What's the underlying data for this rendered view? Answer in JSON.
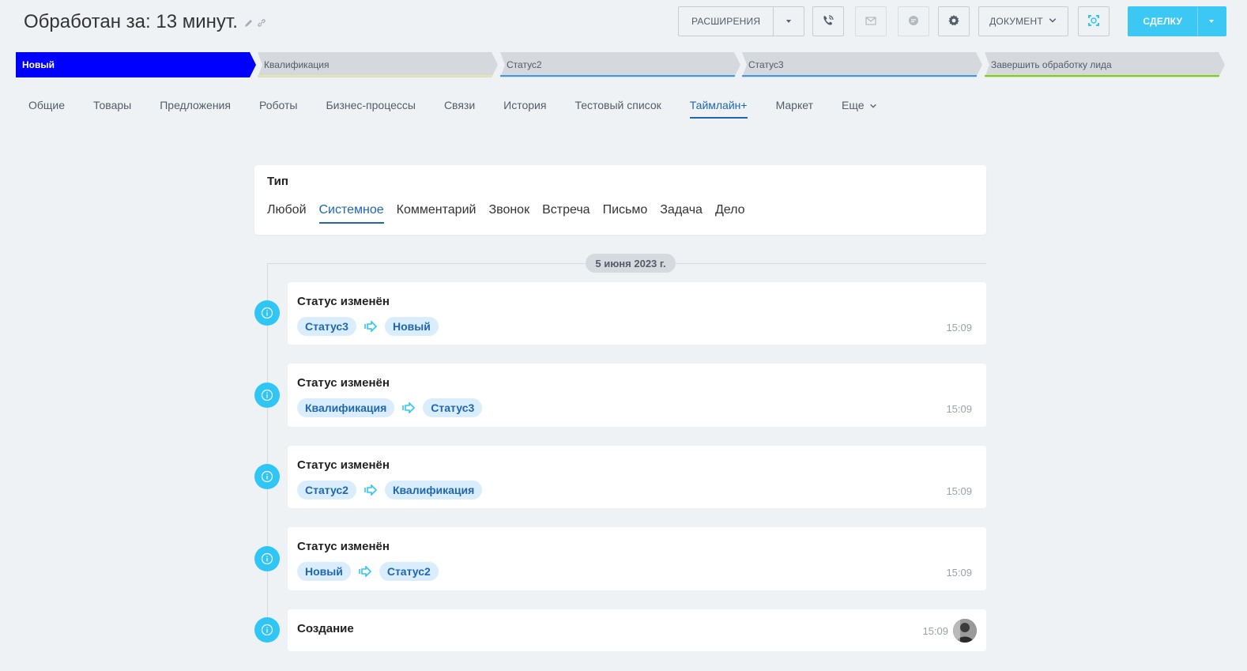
{
  "header": {
    "title": "Обработан за: 13 минут.",
    "extensions_label": "РАСШИРЕНИЯ",
    "document_label": "ДОКУМЕНТ",
    "deal_label": "СДЕЛКУ"
  },
  "stages": [
    {
      "label": "Новый",
      "color": "#0000ff",
      "active": true
    },
    {
      "label": "Квалификация",
      "color": "#e5e8a0"
    },
    {
      "label": "Статус2",
      "color": "#3d9be6"
    },
    {
      "label": "Статус3",
      "color": "#3d9be6"
    },
    {
      "label": "Завершить обработку лида",
      "color": "#7bd500"
    }
  ],
  "tabs": [
    {
      "label": "Общие"
    },
    {
      "label": "Товары"
    },
    {
      "label": "Предложения"
    },
    {
      "label": "Роботы"
    },
    {
      "label": "Бизнес-процессы"
    },
    {
      "label": "Связи"
    },
    {
      "label": "История"
    },
    {
      "label": "Тестовый список"
    },
    {
      "label": "Таймлайн+",
      "active": true
    },
    {
      "label": "Маркет"
    },
    {
      "label": "Еще"
    }
  ],
  "filter": {
    "title": "Тип",
    "options": [
      "Любой",
      "Системное",
      "Комментарий",
      "Звонок",
      "Встреча",
      "Письмо",
      "Задача",
      "Дело"
    ],
    "selected": "Системное"
  },
  "timeline": {
    "date": "5 июня 2023 г.",
    "items": [
      {
        "title": "Статус изменён",
        "from": "Статус3",
        "to": "Новый",
        "time": "15:09"
      },
      {
        "title": "Статус изменён",
        "from": "Квалификация",
        "to": "Статус3",
        "time": "15:09"
      },
      {
        "title": "Статус изменён",
        "from": "Статус2",
        "to": "Квалификация",
        "time": "15:09"
      },
      {
        "title": "Статус изменён",
        "from": "Новый",
        "to": "Статус2",
        "time": "15:09"
      },
      {
        "title": "Создание",
        "time": "15:09"
      }
    ]
  },
  "icons": {
    "edit": "pencil-icon",
    "link": "link-icon",
    "phone": "phone-icon",
    "mail": "mail-icon",
    "chat": "chat-icon",
    "settings": "gear-icon",
    "scan": "scan-icon",
    "info": "info-icon",
    "arrow": "arrow-right-icon"
  }
}
